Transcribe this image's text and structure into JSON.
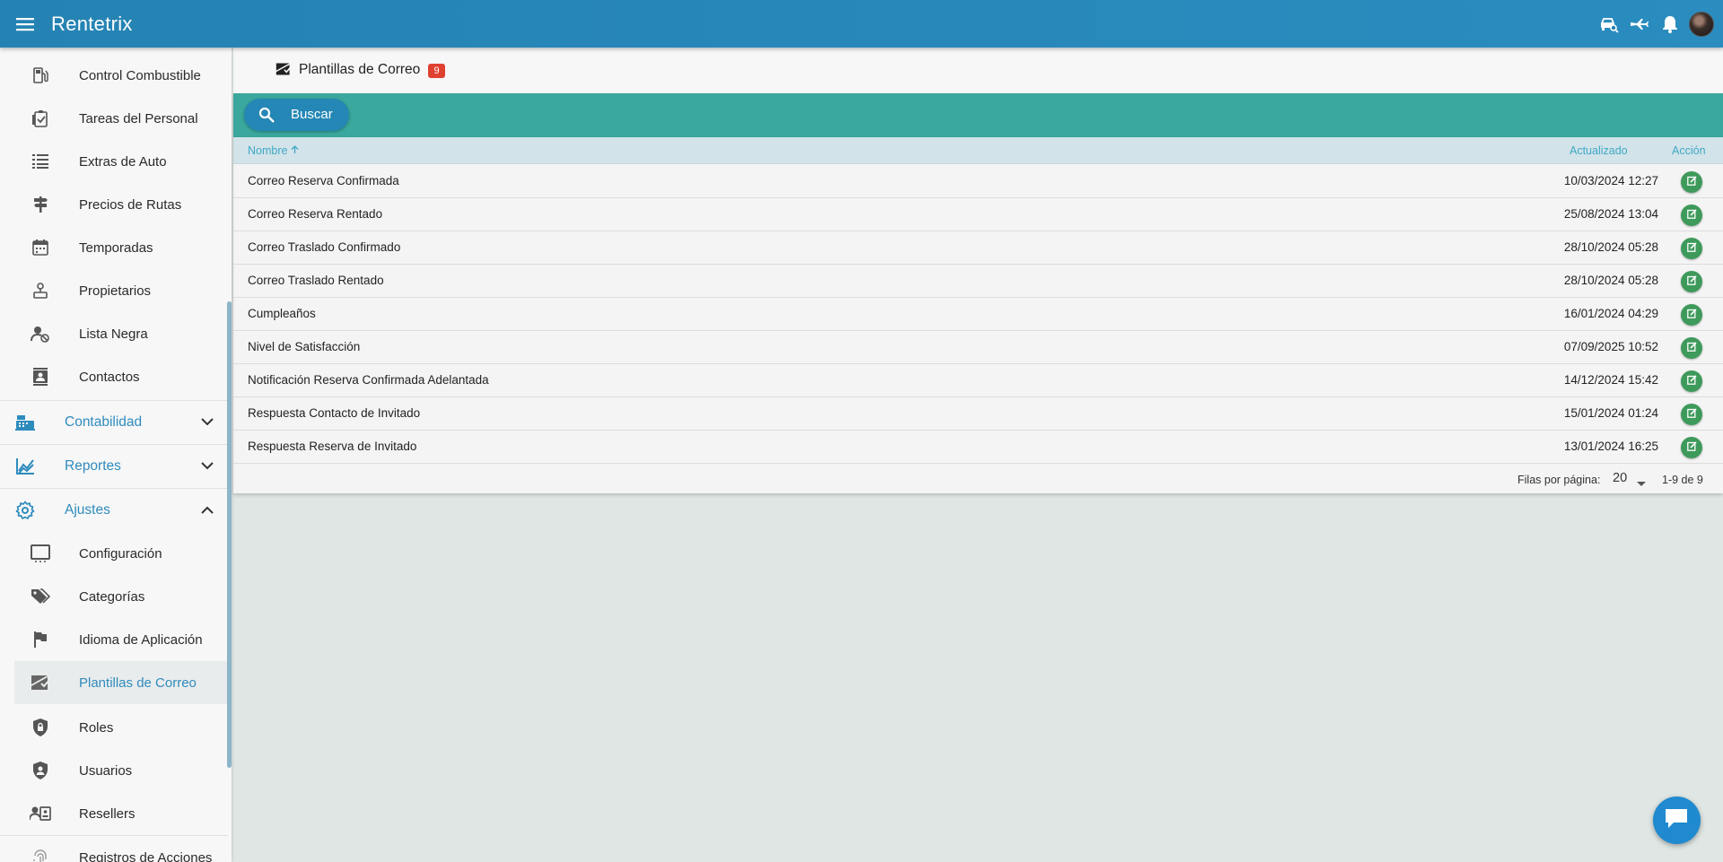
{
  "appbar": {
    "title": "Rentetrix",
    "icons": [
      "menu-icon",
      "car-search-icon",
      "airplane-icon",
      "bell-icon",
      "avatar"
    ]
  },
  "sidebar": {
    "items": [
      {
        "label": "Control Combustible",
        "icon": "fuel-icon"
      },
      {
        "label": "Tareas del Personal",
        "icon": "clipboard-check-icon"
      },
      {
        "label": "Extras de Auto",
        "icon": "list-icon"
      },
      {
        "label": "Precios de Rutas",
        "icon": "signpost-icon"
      },
      {
        "label": "Temporadas",
        "icon": "calendar-icon"
      },
      {
        "label": "Propietarios",
        "icon": "owner-icon"
      },
      {
        "label": "Lista Negra",
        "icon": "user-block-icon"
      },
      {
        "label": "Contactos",
        "icon": "contacts-icon"
      }
    ],
    "groups": [
      {
        "label": "Contabilidad",
        "icon": "cash-register-icon",
        "expanded": false
      },
      {
        "label": "Reportes",
        "icon": "chart-line-icon",
        "expanded": false
      },
      {
        "label": "Ajustes",
        "icon": "gear-icon",
        "expanded": true
      }
    ],
    "settings_items": [
      {
        "label": "Configuración",
        "icon": "monitor-icon"
      },
      {
        "label": "Categorías",
        "icon": "tags-icon"
      },
      {
        "label": "Idioma de Aplicación",
        "icon": "flag-icon"
      },
      {
        "label": "Plantillas de Correo",
        "icon": "email-template-icon",
        "active": true
      },
      {
        "label": "Roles",
        "icon": "shield-lock-icon"
      },
      {
        "label": "Usuarios",
        "icon": "shield-user-icon"
      },
      {
        "label": "Resellers",
        "icon": "reseller-icon"
      },
      {
        "label": "Registros de Acciones",
        "icon": "fingerprint-icon"
      }
    ]
  },
  "page": {
    "title": "Plantillas de Correo",
    "count": "9",
    "search_label": "Buscar"
  },
  "table": {
    "columns": {
      "name": "Nombre",
      "updated": "Actualizado",
      "action": "Acción"
    },
    "rows": [
      {
        "name": "Correo Reserva Confirmada",
        "updated": "10/03/2024 12:27"
      },
      {
        "name": "Correo Reserva Rentado",
        "updated": "25/08/2024 13:04"
      },
      {
        "name": "Correo Traslado Confirmado",
        "updated": "28/10/2024 05:28"
      },
      {
        "name": "Correo Traslado Rentado",
        "updated": "28/10/2024 05:28"
      },
      {
        "name": "Cumpleaños",
        "updated": "16/01/2024 04:29"
      },
      {
        "name": "Nivel de Satisfacción",
        "updated": "07/09/2025 10:52"
      },
      {
        "name": "Notificación Reserva Confirmada Adelantada",
        "updated": "14/12/2024 15:42"
      },
      {
        "name": "Respuesta Contacto de Invitado",
        "updated": "15/01/2024 01:24"
      },
      {
        "name": "Respuesta Reserva de Invitado",
        "updated": "13/01/2024 16:25"
      }
    ],
    "footer": {
      "rows_per_page_label": "Filas por página:",
      "rows_per_page": "20",
      "range": "1-9 de 9"
    }
  },
  "colors": {
    "appbar": "#2583b3",
    "accent": "#2e8bbd",
    "toolbar": "#3aa89d",
    "edit_button": "#3e9a5b",
    "badge": "#e0402f"
  }
}
